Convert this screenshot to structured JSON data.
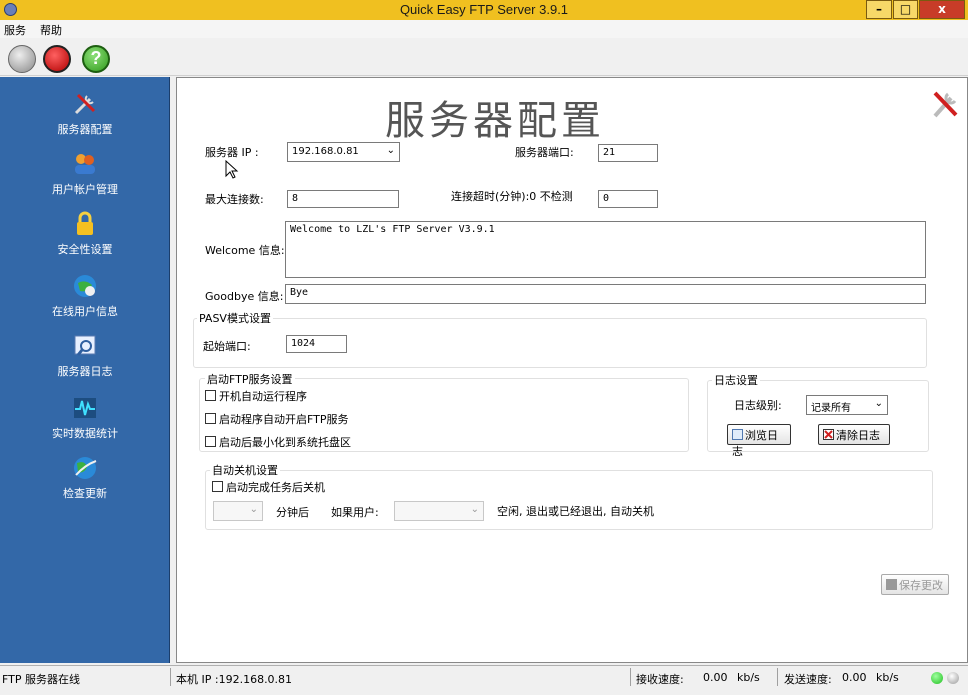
{
  "window": {
    "title": "Quick Easy FTP Server 3.9.1",
    "min_symbol": "–",
    "max_symbol": "□",
    "close_symbol": "x"
  },
  "menu": [
    "服务",
    "帮助"
  ],
  "toolbar": {
    "help_symbol": "?"
  },
  "sidebar": {
    "items": [
      {
        "label": "服务器配置",
        "icon": "tools-icon"
      },
      {
        "label": "用户帐户管理",
        "icon": "users-icon"
      },
      {
        "label": "安全性设置",
        "icon": "lock-icon"
      },
      {
        "label": "在线用户信息",
        "icon": "online-users-icon"
      },
      {
        "label": "服务器日志",
        "icon": "log-icon"
      },
      {
        "label": "实时数据统计",
        "icon": "pulse-icon"
      },
      {
        "label": "检查更新",
        "icon": "globe-icon"
      }
    ]
  },
  "main": {
    "title": "服务器配置",
    "server_ip_label": "服务器 IP :",
    "server_ip_value": "192.168.0.81",
    "server_port_label": "服务器端口:",
    "server_port_value": "21",
    "max_conn_label": "最大连接数:",
    "max_conn_value": "8",
    "timeout_label": "连接超时(分钟):0 不检测",
    "timeout_value": "0",
    "welcome_label": "Welcome 信息:",
    "welcome_value": "Welcome to LZL's FTP Server V3.9.1",
    "goodbye_label": "Goodbye 信息:",
    "goodbye_value": "Bye",
    "pasv": {
      "title": "PASV模式设置",
      "start_port_label": "起始端口:",
      "start_port_value": "1024"
    },
    "startup": {
      "title": "启动FTP服务设置",
      "options": [
        "开机自动运行程序",
        "启动程序自动开启FTP服务",
        "启动后最小化到系统托盘区"
      ]
    },
    "log": {
      "title": "日志设置",
      "level_label": "日志级别:",
      "level_value": "记录所有",
      "browse_label": "浏览日志",
      "clear_label": "清除日志"
    },
    "shutdown": {
      "title": "自动关机设置",
      "option": "启动完成任务后关机",
      "minutes_label": "分钟后",
      "if_user_label": "如果用户:",
      "tail_text": "空闲, 退出或已经退出, 自动关机"
    },
    "save_label": "保存更改"
  },
  "status": {
    "server_state": "FTP 服务器在线",
    "local_ip": "本机 IP :192.168.0.81",
    "recv_label": "接收速度:",
    "recv_value": "0.00",
    "recv_unit": "kb/s",
    "send_label": "发送速度:",
    "send_value": "0.00",
    "send_unit": "kb/s"
  },
  "colors": {
    "titlebar": "#f0c020",
    "sidebar": "#3368a8",
    "led_on": "#20c020"
  }
}
